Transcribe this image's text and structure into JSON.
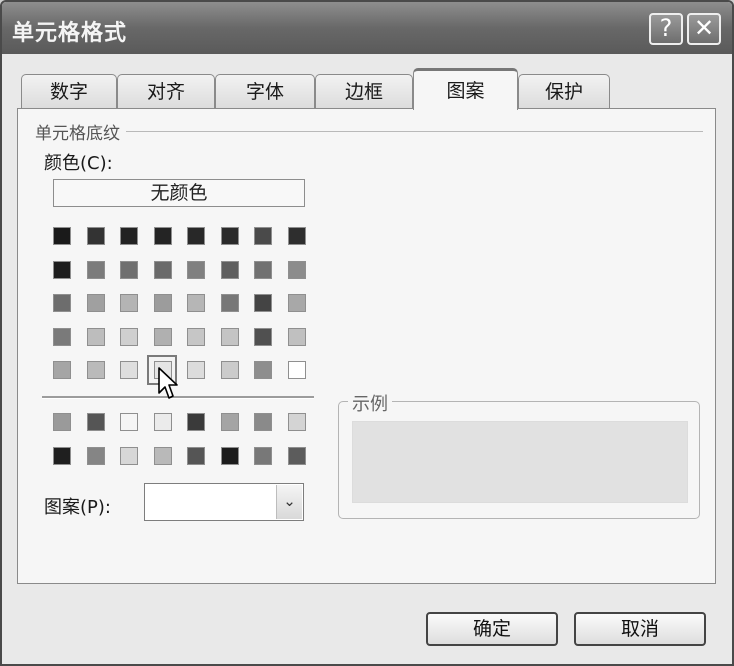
{
  "dialog": {
    "title": "单元格格式",
    "help_glyph": "?",
    "close_glyph": "✕"
  },
  "tabs": [
    {
      "label": "数字",
      "active": false
    },
    {
      "label": "对齐",
      "active": false
    },
    {
      "label": "字体",
      "active": false
    },
    {
      "label": "边框",
      "active": false
    },
    {
      "label": "图案",
      "active": true
    },
    {
      "label": "保护",
      "active": false
    }
  ],
  "shading": {
    "group_label": "单元格底纹",
    "color_label": "颜色(C):",
    "no_color_label": "无颜色",
    "palette_rows": [
      [
        "#1a1a1a",
        "#333333",
        "#222222",
        "#242424",
        "#282828",
        "#2a2a2a",
        "#4a4a4a",
        "#2e2e2e"
      ],
      [
        "#1e1e1e",
        "#7b7b7b",
        "#6f6f6f",
        "#6a6a6a",
        "#808080",
        "#5e5e5e",
        "#717171",
        "#8c8c8c"
      ],
      [
        "#6d6d6d",
        "#a0a0a0",
        "#b4b4b4",
        "#9c9c9c",
        "#b6b6b6",
        "#777777",
        "#444444",
        "#a8a8a8"
      ],
      [
        "#7a7a7a",
        "#bdbdbd",
        "#cfcfcf",
        "#b0b0b0",
        "#c6c6c6",
        "#c4c4c4",
        "#505050",
        "#c0c0c0"
      ],
      [
        "#a5a5a5",
        "#bababa",
        "#dedede",
        "#e5e5e5",
        "#dcdcdc",
        "#cbcbcb",
        "#8e8e8e",
        "#ffffff"
      ]
    ],
    "extra_rows": [
      [
        "#9a9a9a",
        "#555555",
        "#f5f5f5",
        "#ebebeb",
        "#3a3a3a",
        "#a4a4a4",
        "#8a8a8a",
        "#d4d4d4"
      ],
      [
        "#1f1f1f",
        "#858585",
        "#d7d7d7",
        "#b9b9b9",
        "#555555",
        "#1c1c1c",
        "#787878",
        "#5c5c5c"
      ]
    ],
    "pattern_label": "图案(P):",
    "pattern_value": "",
    "dropdown_glyph": "⌄"
  },
  "sample": {
    "label": "示例",
    "color": "#e1e1e1"
  },
  "buttons": {
    "ok": "确定",
    "cancel": "取消"
  }
}
